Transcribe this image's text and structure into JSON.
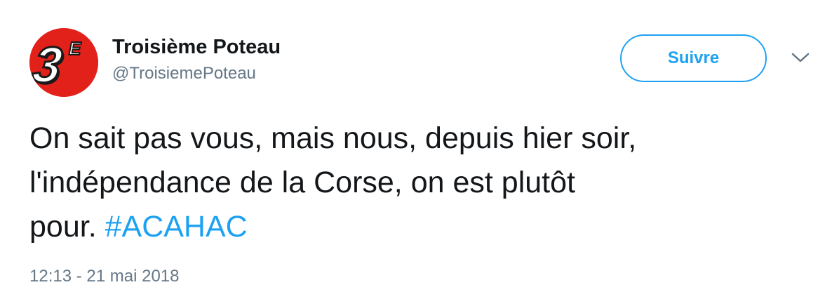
{
  "author": {
    "name": "Troisième Poteau",
    "handle": "@TroisiemePoteau",
    "avatar_icon": "troisieme-poteau-logo",
    "avatar_text": "3E"
  },
  "follow_button": {
    "label": "Suivre"
  },
  "menu": {
    "icon": "chevron-down-icon"
  },
  "tweet": {
    "text_line1": "On sait pas vous, mais nous, depuis hier soir,",
    "text_line2": "l'indépendance de la Corse, on est plutôt",
    "text_line3": "pour. ",
    "hashtag": "#ACAHAC",
    "timestamp": "12:13 - 21 mai 2018"
  },
  "colors": {
    "accent": "#1da1f2",
    "text": "#14171a",
    "secondary": "#657786",
    "brand_red": "#e3211b"
  }
}
